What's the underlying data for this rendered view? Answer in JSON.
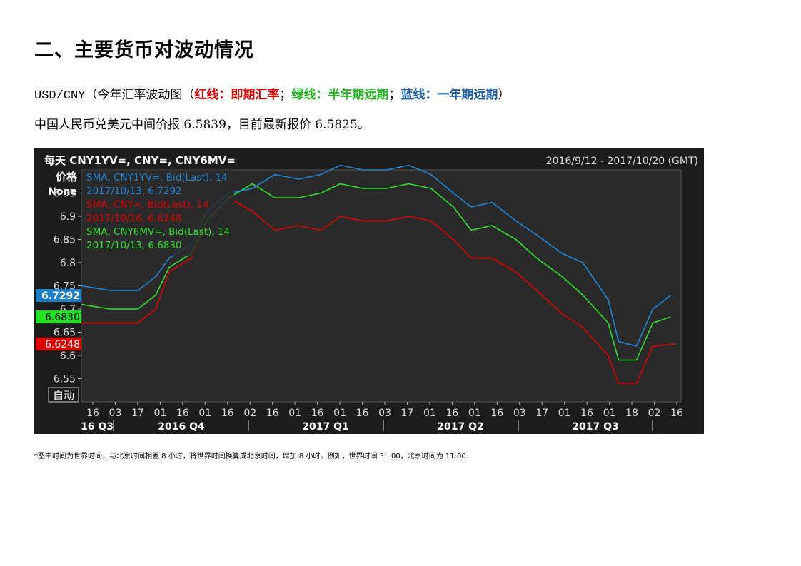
{
  "heading": "二、主要货币对波动情况",
  "subtitle": {
    "pair": "USD/CNY",
    "prefix": "（今年汇率波动图（",
    "red_label": "红线：即期汇率",
    "sep1": "；",
    "green_label": "绿线：半年期远期",
    "sep2": "；",
    "blue_label": "蓝线：一年期远期",
    "suffix": "）"
  },
  "summary": "中国人民币兑美元中间价报 6.5839，目前最新报价 6.5825。",
  "footnote": "*图中时间为世界时间，与北京时间相差 8 小时，将世界时间换算成北京时间，增加 8 小时。例如，世界时间 3：00，北京时间为 11:00.",
  "colors": {
    "red": "#e00000",
    "green": "#22b822",
    "blue": "#1f5fa8"
  },
  "chart_data": {
    "type": "line",
    "title": "每天 CNY1YV=, CNY=, CNY6MV=",
    "date_range": "2016/9/12 - 2017/10/20 (GMT)",
    "ylabel": "价格",
    "ylabel_unit": "None",
    "auto_button": "自动",
    "ylim": [
      6.5,
      7.0
    ],
    "yticks": [
      "6.55",
      "6.6",
      "6.65",
      "6.7",
      "6.75",
      "6.8",
      "6.85",
      "6.9",
      "6.95"
    ],
    "xticks": [
      "16",
      "03",
      "17",
      "01",
      "16",
      "01",
      "16",
      "02",
      "16",
      "01",
      "16",
      "01",
      "16",
      "03",
      "17",
      "01",
      "16",
      "01",
      "16",
      "03",
      "17",
      "01",
      "16",
      "01",
      "18",
      "02",
      "16"
    ],
    "quarters": [
      "16 Q3",
      "2016 Q4",
      "2017 Q1",
      "2017 Q2",
      "2017 Q3"
    ],
    "x_range": [
      "2016-09-12",
      "2017-10-20"
    ],
    "series": [
      {
        "name": "SMA, CNY1YV=, Bid(Last),  14",
        "last_label": "2017/10/13, 6.7292",
        "last_value": "6.7292",
        "color": "#1f86d6",
        "x": [
          "2016-09-12",
          "2016-10-01",
          "2016-10-20",
          "2016-11-01",
          "2016-11-10",
          "2016-11-25",
          "2016-12-05",
          "2016-12-20",
          "2017-01-05",
          "2017-01-20",
          "2017-02-05",
          "2017-02-20",
          "2017-03-05",
          "2017-03-20",
          "2017-04-05",
          "2017-04-20",
          "2017-05-05",
          "2017-05-20",
          "2017-06-01",
          "2017-06-15",
          "2017-07-01",
          "2017-07-15",
          "2017-08-01",
          "2017-08-15",
          "2017-09-01",
          "2017-09-08",
          "2017-09-20",
          "2017-10-01",
          "2017-10-13"
        ],
        "values": [
          6.75,
          6.74,
          6.74,
          6.77,
          6.81,
          6.84,
          6.91,
          6.95,
          6.96,
          6.99,
          6.98,
          6.99,
          7.01,
          7.0,
          7.0,
          7.01,
          6.99,
          6.95,
          6.92,
          6.93,
          6.89,
          6.86,
          6.82,
          6.8,
          6.72,
          6.63,
          6.62,
          6.7,
          6.7292
        ]
      },
      {
        "name": "SMA, CNY=, Bid(Last),  14",
        "last_label": "2017/10/16, 6.6248",
        "last_value": "6.6248",
        "color": "#e00000",
        "x": [
          "2016-09-12",
          "2016-10-01",
          "2016-10-20",
          "2016-11-01",
          "2016-11-10",
          "2016-11-25",
          "2016-12-05",
          "2016-12-20",
          "2017-01-05",
          "2017-01-20",
          "2017-02-05",
          "2017-02-20",
          "2017-03-05",
          "2017-03-20",
          "2017-04-05",
          "2017-04-20",
          "2017-05-05",
          "2017-05-20",
          "2017-06-01",
          "2017-06-15",
          "2017-07-01",
          "2017-07-15",
          "2017-08-01",
          "2017-08-15",
          "2017-09-01",
          "2017-09-08",
          "2017-09-20",
          "2017-10-01",
          "2017-10-16"
        ],
        "values": [
          6.67,
          6.67,
          6.67,
          6.7,
          6.78,
          6.81,
          6.89,
          6.94,
          6.91,
          6.87,
          6.88,
          6.87,
          6.9,
          6.89,
          6.89,
          6.9,
          6.89,
          6.85,
          6.81,
          6.81,
          6.78,
          6.74,
          6.69,
          6.66,
          6.6,
          6.54,
          6.54,
          6.62,
          6.6248
        ]
      },
      {
        "name": "SMA, CNY6MV=, Bid(Last),  14",
        "last_label": "2017/10/13, 6.6830",
        "last_value": "6.6830",
        "color": "#2ee02e",
        "x": [
          "2016-09-12",
          "2016-10-01",
          "2016-10-20",
          "2016-11-01",
          "2016-11-10",
          "2016-11-25",
          "2016-12-05",
          "2016-12-20",
          "2017-01-05",
          "2017-01-20",
          "2017-02-05",
          "2017-02-20",
          "2017-03-05",
          "2017-03-20",
          "2017-04-05",
          "2017-04-20",
          "2017-05-05",
          "2017-05-20",
          "2017-06-01",
          "2017-06-15",
          "2017-07-01",
          "2017-07-15",
          "2017-08-01",
          "2017-08-15",
          "2017-09-01",
          "2017-09-08",
          "2017-09-20",
          "2017-10-01",
          "2017-10-13"
        ],
        "values": [
          6.71,
          6.7,
          6.7,
          6.73,
          6.79,
          6.82,
          6.89,
          6.94,
          6.97,
          6.94,
          6.94,
          6.95,
          6.97,
          6.96,
          6.96,
          6.97,
          6.96,
          6.92,
          6.87,
          6.88,
          6.85,
          6.81,
          6.77,
          6.73,
          6.67,
          6.59,
          6.59,
          6.67,
          6.683
        ]
      }
    ]
  }
}
